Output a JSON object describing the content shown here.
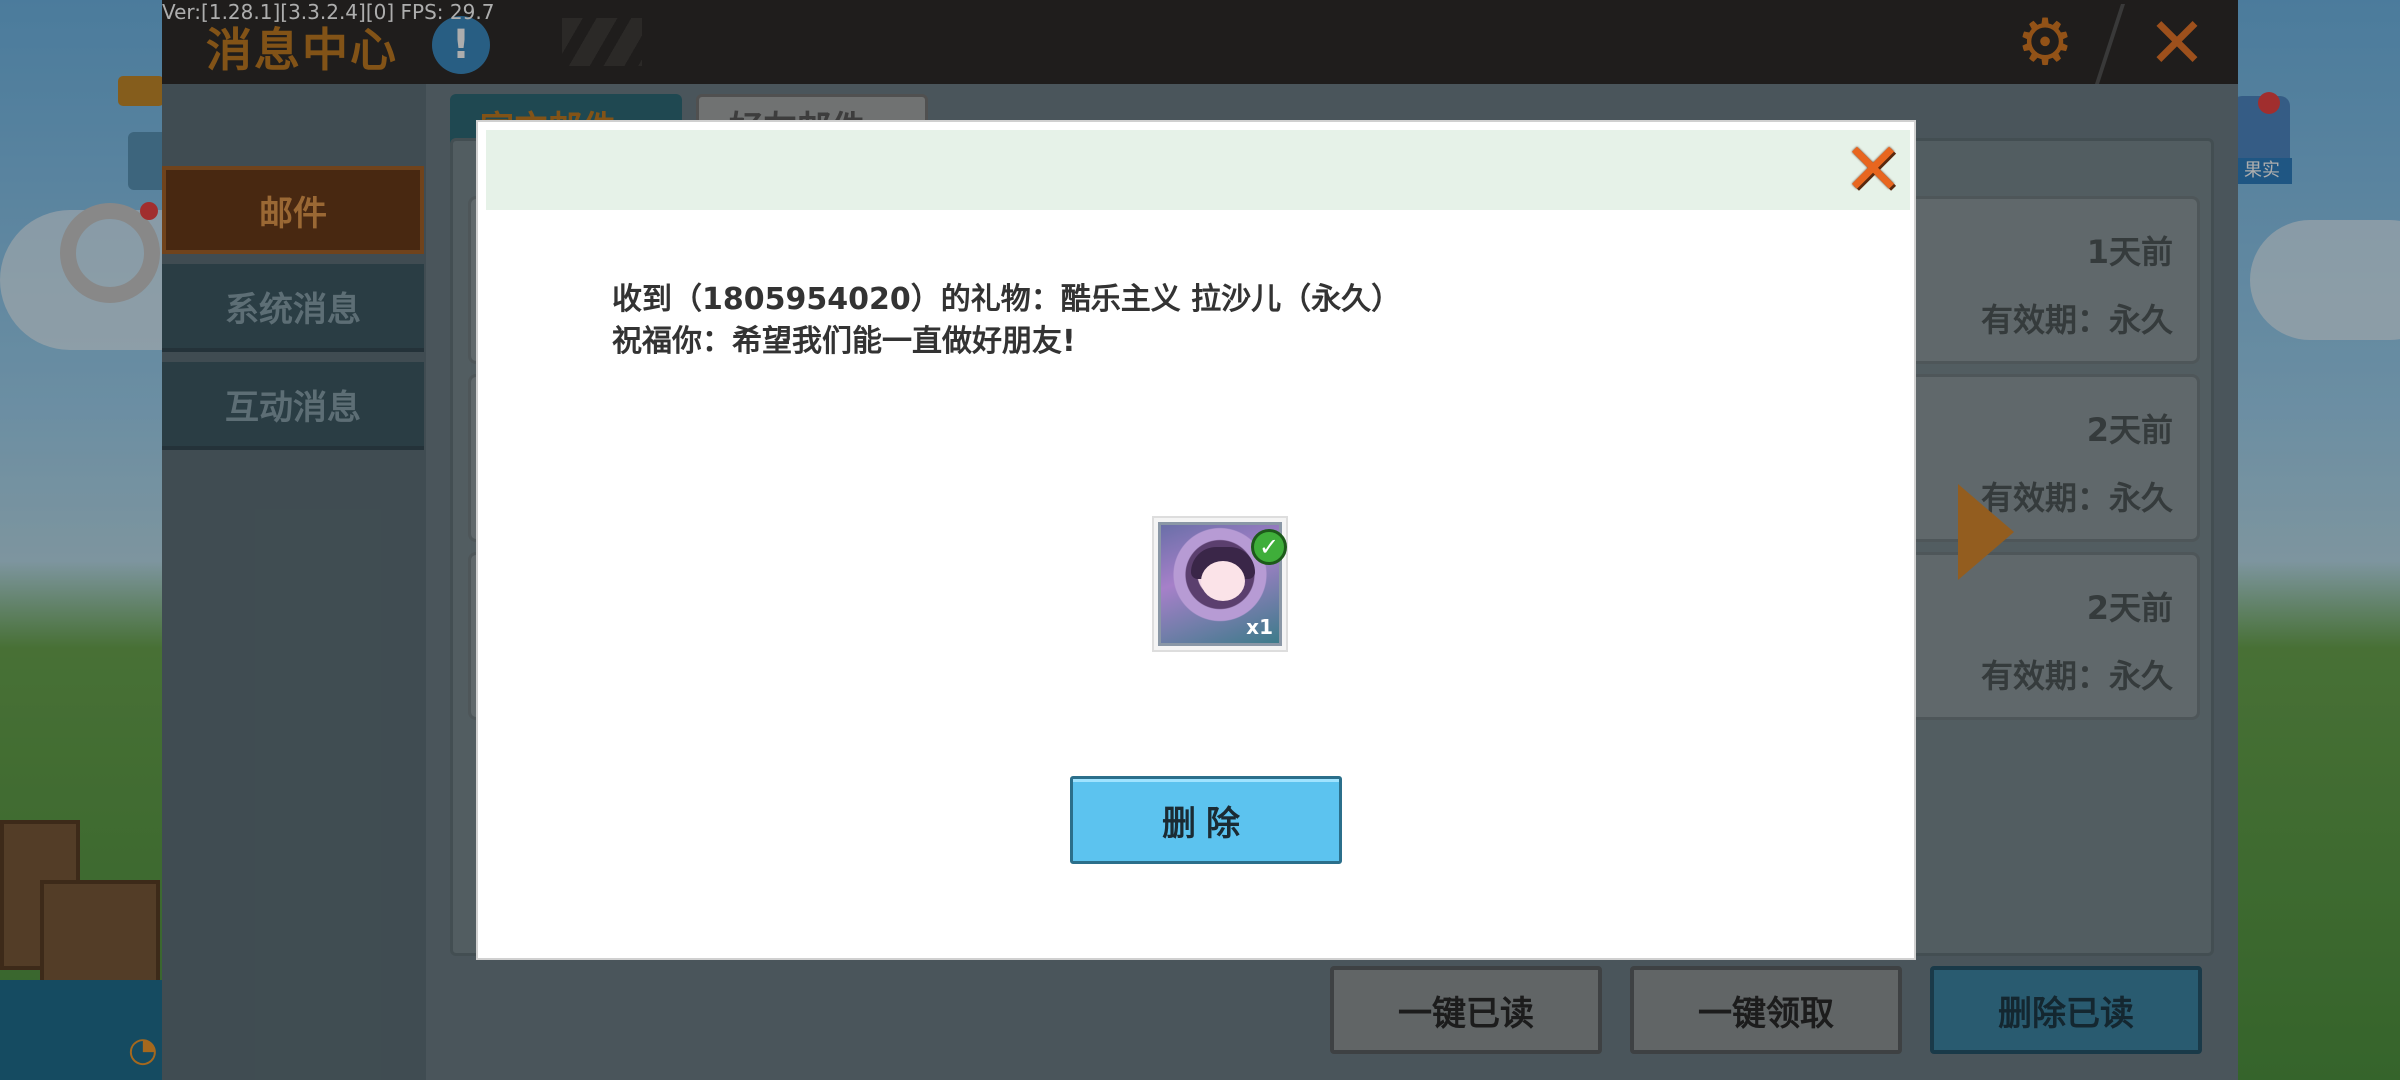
{
  "debug": {
    "version_fps": "Ver:[1.28.1][3.3.2.4][0] FPS: 29.7"
  },
  "topbar": {
    "title": "消息中心",
    "info_icon": "!",
    "gear_icon": "⚙",
    "close_icon": "✕"
  },
  "right_hud": {
    "label": "果实"
  },
  "sidebar": {
    "items": [
      {
        "label": "邮件",
        "active": true
      },
      {
        "label": "系统消息",
        "active": false
      },
      {
        "label": "互动消息",
        "active": false
      }
    ]
  },
  "tabs": [
    {
      "label": "官方邮件"
    },
    {
      "label": "好友邮件"
    }
  ],
  "mail_list": [
    {
      "time": "1天前",
      "valid": "有效期：永久"
    },
    {
      "time": "2天前",
      "valid": "有效期：永久"
    },
    {
      "time": "2天前",
      "valid": "有效期：永久"
    }
  ],
  "bottom_buttons": {
    "read_all": "一键已读",
    "claim_all": "一键领取",
    "delete_read": "删除已读"
  },
  "modal": {
    "close_icon": "✕",
    "line1": "收到（1805954020）的礼物：酷乐主义 拉沙儿（永久）",
    "line2": "祝福你：希望我们能一直做好朋友!",
    "gift_check": "✓",
    "gift_count": "x1",
    "delete_label": "删除"
  },
  "colors": {
    "accent_orange": "#e8772a",
    "active_tab_bg": "#6b3c1a",
    "delete_button": "#5cc3ef"
  }
}
